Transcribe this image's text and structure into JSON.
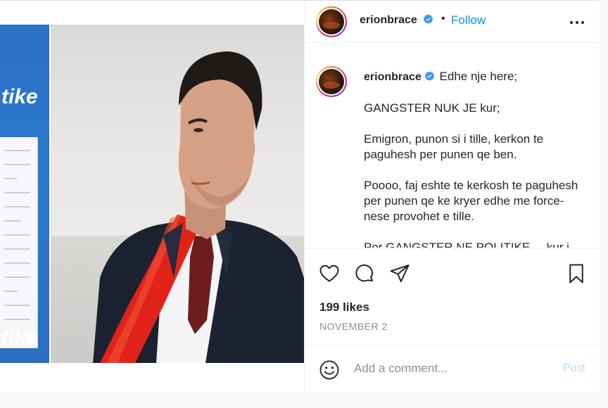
{
  "post": {
    "username": "erionbrace",
    "follow_label": "Follow",
    "separator": "•",
    "more_icon": "more-horizontal-icon"
  },
  "image": {
    "banner_word_top": "tike",
    "banner_word_bottom": "tike"
  },
  "caption": {
    "username": "erionbrace",
    "paragraphs": [
      "Edhe nje here;",
      "GANGSTER NUK JE kur;",
      "Emigron, punon si i tille, kerkon te paguhesh per punen qe ben.",
      "Poooo, faj eshte te kerkosh te paguhesh per punen qe ke kryer edhe me force- nese provohet e tille.",
      "Por GANGSTER NE POLITIKE ... kur i ..."
    ]
  },
  "actions": {
    "like_icon": "heart-icon",
    "comment_icon": "comment-icon",
    "share_icon": "share-icon",
    "save_icon": "bookmark-icon",
    "likes_text": "199 likes",
    "date_text": "NOVEMBER 2"
  },
  "comment": {
    "placeholder": "Add a comment...",
    "post_label": "Post",
    "emoji_icon": "emoji-icon"
  },
  "colors": {
    "accent": "#0095f6",
    "post_disabled": "#b3dbff",
    "muted": "#8e8e8e",
    "text": "#262626",
    "verified": "#3897f0"
  }
}
